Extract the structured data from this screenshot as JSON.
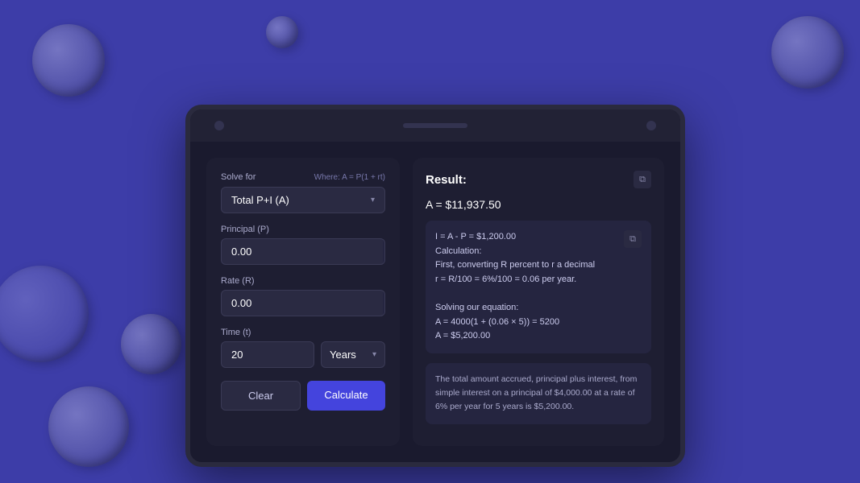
{
  "background": {
    "color": "#3d3da8"
  },
  "calculator": {
    "solve_for_label": "Solve for",
    "formula_label": "Where: A = P(1 + rt)",
    "solve_for_value": "Total P+I (A)",
    "principal_label": "Principal (P)",
    "principal_value": "0.00",
    "principal_suffix": "$",
    "rate_label": "Rate (R)",
    "rate_value": "0.00",
    "rate_suffix": "%",
    "time_label": "Time (t)",
    "time_value": "20",
    "time_unit": "Years",
    "clear_label": "Clear",
    "calculate_label": "Calculate"
  },
  "result": {
    "title": "Result:",
    "main_value": "A = $11,937.50",
    "detail_line1": "I = A - P = $1,200.00",
    "detail_line2": "Calculation:",
    "detail_line3": "First, converting R percent to r a decimal",
    "detail_line4": "r = R/100 = 6%/100 = 0.06 per year.",
    "detail_line5": "",
    "detail_line6": "Solving our equation:",
    "detail_line7": "A = 4000(1 + (0.06 × 5)) = 5200",
    "detail_line8": "A = $5,200.00",
    "detail_line9": "",
    "full_text": "The total amount accrued, principal plus interest, from simple interest on a principal of $4,000.00 at a rate of 6% per year for 5 years is $5,200.00."
  },
  "icons": {
    "chevron_down": "▾",
    "copy": "⧉"
  }
}
